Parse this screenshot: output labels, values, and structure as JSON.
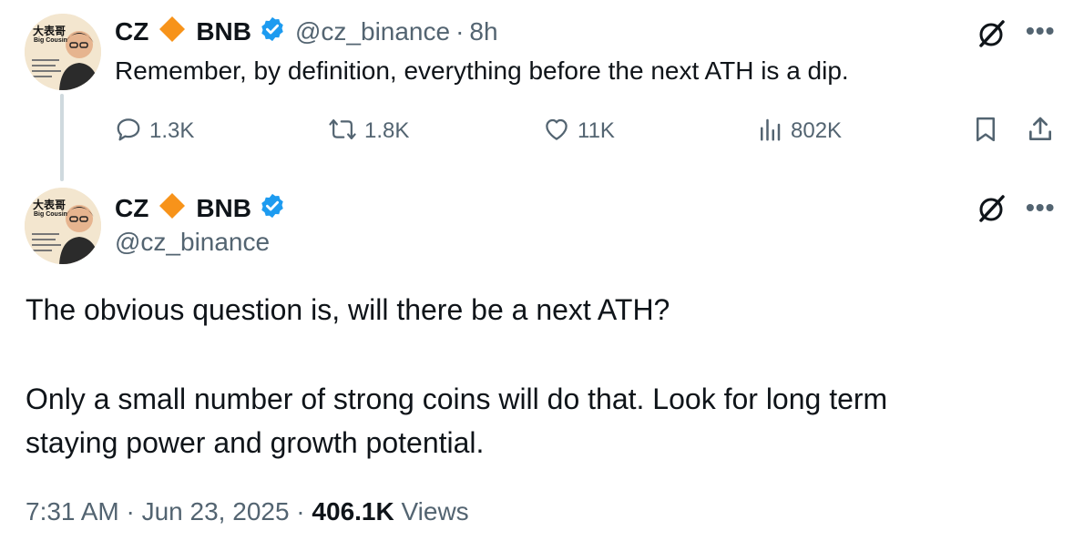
{
  "reply_tweet": {
    "avatar": {
      "caption_cn": "大表哥",
      "caption_en": "Big Cousin"
    },
    "display_name": "CZ",
    "brand_name": "BNB",
    "handle": "@cz_binance",
    "separator": "·",
    "time": "8h",
    "text": "Remember, by definition, everything before the next ATH is a dip.",
    "actions": {
      "replies": "1.3K",
      "reposts": "1.8K",
      "likes": "11K",
      "views": "802K"
    }
  },
  "main_tweet": {
    "avatar": {
      "caption_cn": "大表哥",
      "caption_en": "Big Cousin"
    },
    "display_name": "CZ",
    "brand_name": "BNB",
    "handle": "@cz_binance",
    "line1": "The obvious question is, will there be a next ATH?",
    "line2": "Only a small number of strong coins will do that. Look for long term",
    "line3": "staying power and growth potential.",
    "timestamp": "7:31 AM · Jun 23, 2025 ·",
    "views_count": "406.1K",
    "views_label": "Views"
  },
  "icons": [
    "diamond-icon",
    "verified-badge-icon",
    "grok-icon",
    "more-icon",
    "reply-icon",
    "repost-icon",
    "like-icon",
    "views-icon",
    "bookmark-icon",
    "share-icon"
  ],
  "colors": {
    "diamond": "#f7931a",
    "verified": "#1d9bf0",
    "text": "#0f1419",
    "muted": "#536471",
    "thread_line": "#cfd9de"
  }
}
